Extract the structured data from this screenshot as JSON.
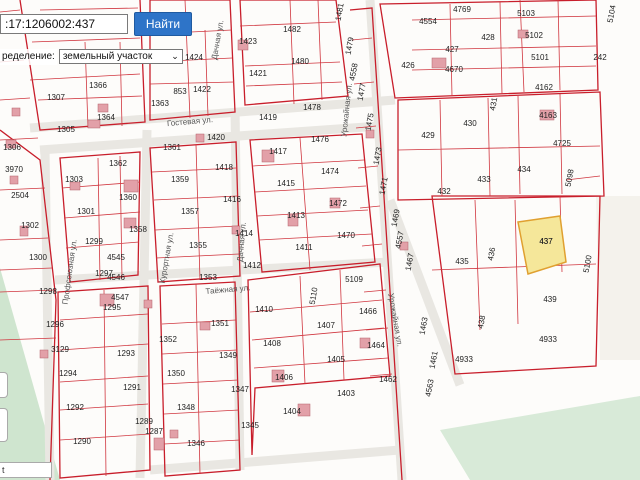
{
  "search": {
    "value": ":17:1206002:437",
    "button_label": "Найти"
  },
  "definition": {
    "label": "ределение:",
    "selected": "земельный участок"
  },
  "scale_text": "t",
  "colors": {
    "parcel_border": "#d0363f",
    "block_border": "#c81e2b",
    "highlight_fill": "#f5e79a",
    "highlight_border": "#e0a030",
    "green": "#cfe5cf",
    "building": "#e2a0a8"
  },
  "streets": [
    {
      "name": "Гостевая ул."
    },
    {
      "name": "Дачная ул."
    },
    {
      "name": "Дачная ул."
    },
    {
      "name": "Урожайная ул."
    },
    {
      "name": "Урожайная ул."
    },
    {
      "name": "Таёжная ул."
    },
    {
      "name": "Курортная ул."
    },
    {
      "name": "Профсоюзная ул."
    }
  ],
  "parcels": [
    "1307",
    "1366",
    "1305",
    "1364",
    "1306",
    "3970",
    "2504",
    "1303",
    "1362",
    "1301",
    "1360",
    "1299",
    "1358",
    "1302",
    "1300",
    "1297",
    "1298",
    "1295",
    "1296",
    "3129",
    "1294",
    "1292",
    "1290",
    "1293",
    "1291",
    "1289",
    "1287",
    "1352",
    "1350",
    "1348",
    "1346",
    "1424",
    "1422",
    "1421",
    "1363",
    "1361",
    "1420",
    "1359",
    "1418",
    "1357",
    "1416",
    "1355",
    "1414",
    "1353",
    "1412",
    "1423",
    "1482",
    "1480",
    "1419",
    "1478",
    "1417",
    "1476",
    "1415",
    "1474",
    "1413",
    "1472",
    "1411",
    "1470",
    "1351",
    "1410",
    "1349",
    "1408",
    "1347",
    "1406",
    "1345",
    "1404",
    "5110",
    "5109",
    "1407",
    "1466",
    "1405",
    "1464",
    "1403",
    "1462",
    "1481",
    "1479",
    "4558",
    "1477",
    "1475",
    "1473",
    "1471",
    "1469",
    "4557",
    "1467",
    "1463",
    "1461",
    "4563",
    "4933",
    "4554",
    "4769",
    "5103",
    "427",
    "4670",
    "428",
    "5102",
    "426",
    "5101",
    "431",
    "4162",
    "429",
    "430",
    "4163",
    "4725",
    "432",
    "433",
    "434",
    "5098",
    "435",
    "436",
    "437",
    "5100",
    "438",
    "439",
    "4545",
    "4546",
    "4547",
    "853",
    "242",
    "5104",
    "4933"
  ],
  "highlighted_parcel": "437"
}
